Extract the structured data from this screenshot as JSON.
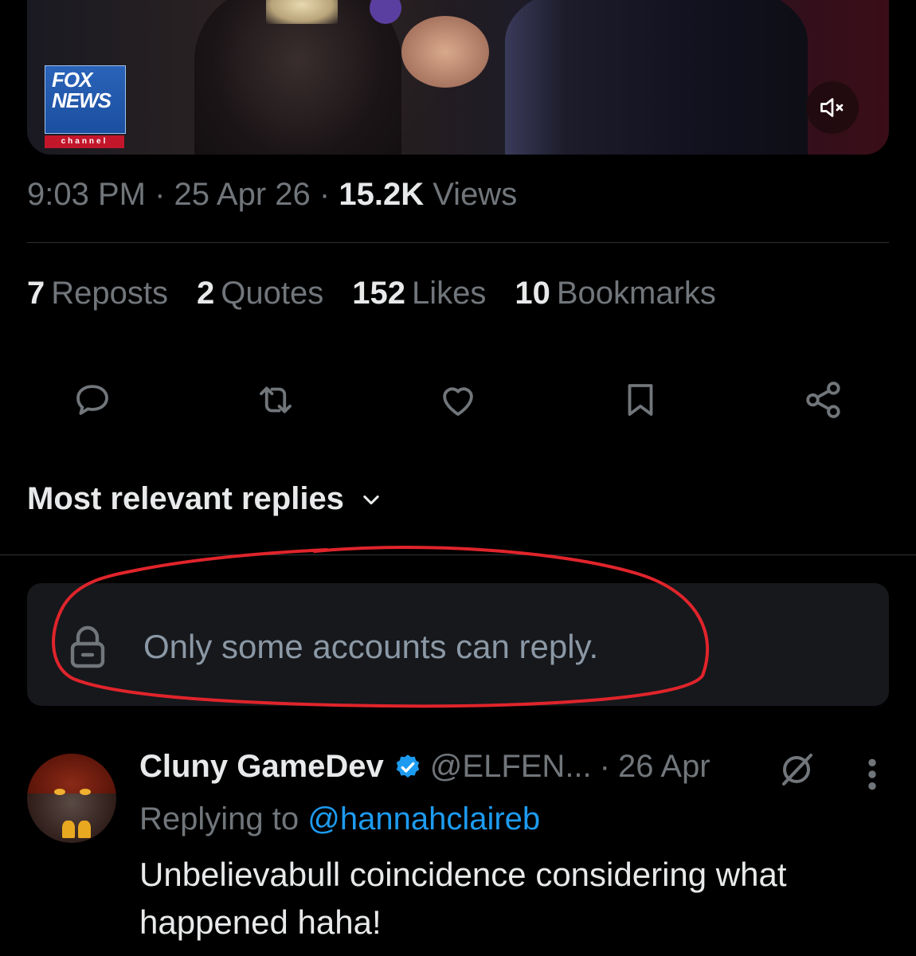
{
  "video": {
    "logo_lines": [
      "FOX",
      "NEWS"
    ],
    "logo_channel": "channel",
    "mute_icon": "speaker-muted-icon"
  },
  "tweet_meta": {
    "time": "9:03 PM",
    "date": "25 Apr 26",
    "views_count": "15.2K",
    "views_label": "Views"
  },
  "stats": [
    {
      "count": "7",
      "label": "Reposts"
    },
    {
      "count": "2",
      "label": "Quotes"
    },
    {
      "count": "152",
      "label": "Likes"
    },
    {
      "count": "10",
      "label": "Bookmarks"
    }
  ],
  "actions": [
    "reply-icon",
    "repost-icon",
    "like-icon",
    "bookmark-icon",
    "share-icon"
  ],
  "replies_sort": {
    "label": "Most relevant replies"
  },
  "reply_restriction": {
    "text": "Only some accounts can reply.",
    "icon": "lock-icon",
    "annotation_color": "#e0242b"
  },
  "reply": {
    "display_name": "Cluny GameDev",
    "handle": "@ELFEN...",
    "separator": "·",
    "date": "26 Apr",
    "replying_prefix": "Replying to",
    "replying_to": "@hannahclaireb",
    "text": "Unbelievabull coincidence considering what happened haha!"
  },
  "colors": {
    "background": "#000000",
    "primary_text": "#e7e9ea",
    "secondary_text": "#71767b",
    "accent": "#1d9bf0",
    "divider": "#2f3336",
    "notice_bg": "#16181c"
  }
}
